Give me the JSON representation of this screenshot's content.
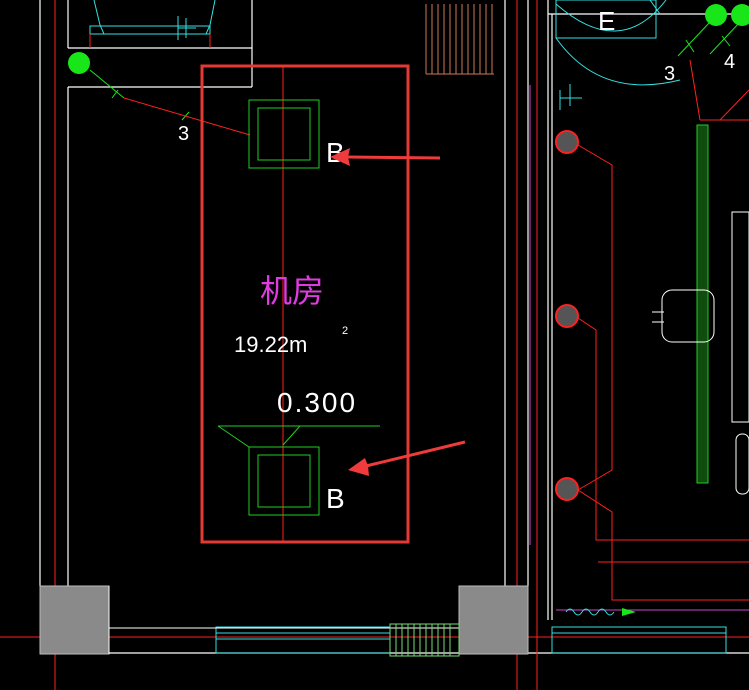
{
  "room": {
    "name": "机房",
    "area_value": "19.22m",
    "area_superscript": "2",
    "elevation": "0.300"
  },
  "labels": {
    "top_square": "B",
    "bottom_square": "B",
    "left_circuit": "3",
    "right_circuit_a": "3",
    "right_circuit_b": "4",
    "door_tag": "E"
  },
  "colors": {
    "background": "#000000",
    "wall": "#ffffff",
    "axis": "#ff2020",
    "highlight_box": "#e53935",
    "arrow": "#ef3b3b",
    "equipment": "#22cc22",
    "cyan_detail": "#35e0e0",
    "room_text": "#e03be0",
    "column_fill": "#8a8a8a",
    "green_node": "#19e619"
  }
}
